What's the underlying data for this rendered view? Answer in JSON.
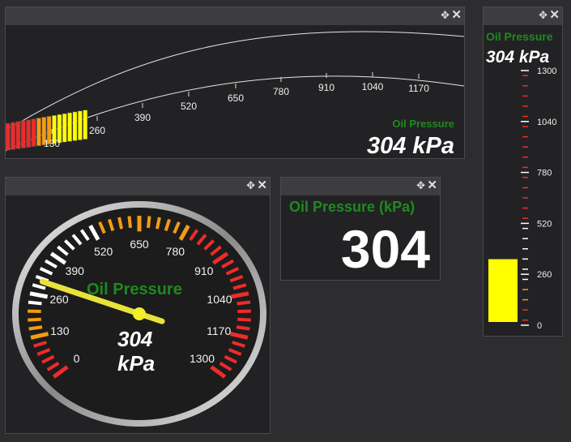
{
  "gauges": {
    "arc": {
      "label": "Oil Pressure",
      "value_text": "304 kPa",
      "ticks": [
        "130",
        "260",
        "390",
        "520",
        "650",
        "780",
        "910",
        "1040",
        "1170"
      ]
    },
    "linear": {
      "label": "Oil Pressure",
      "value_text": "304 kPa",
      "ticks": [
        "1300",
        "1040",
        "780",
        "520",
        "260",
        "0"
      ]
    },
    "dial": {
      "label": "Oil Pressure",
      "value_number": "304",
      "unit": "kPa",
      "ticks": [
        "0",
        "130",
        "260",
        "390",
        "520",
        "650",
        "780",
        "910",
        "1040",
        "1170",
        "1300"
      ]
    },
    "digital": {
      "label": "Oil Pressure (kPa)",
      "value_text": "304"
    }
  },
  "value": 304,
  "min": 0,
  "max": 1300,
  "icons": {
    "move": "move-icon",
    "close": "close-icon"
  },
  "colors": {
    "panel_bg": "#222224",
    "titlebar": "#3c3c41",
    "label": "#1e8a1e",
    "yellow": "#ffff00",
    "orange": "#f39c12",
    "red": "#ee2b2b"
  }
}
